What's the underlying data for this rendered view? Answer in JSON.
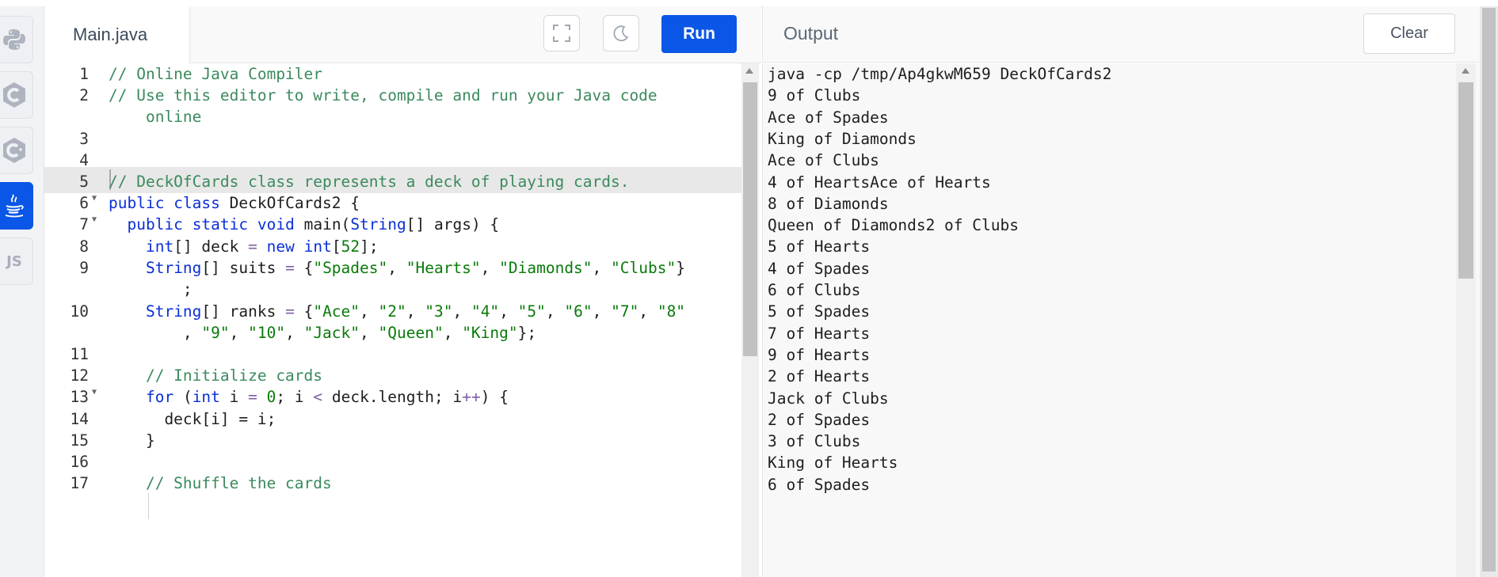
{
  "rail": {
    "languages": [
      {
        "name": "python-icon",
        "label": ""
      },
      {
        "name": "c-icon",
        "label": ""
      },
      {
        "name": "cpp-icon",
        "label": ""
      },
      {
        "name": "java-icon",
        "label": "",
        "active": true
      },
      {
        "name": "javascript-icon",
        "label": "JS"
      }
    ]
  },
  "editor": {
    "tab_label": "Main.java",
    "run_label": "Run",
    "fullscreen_icon": "fullscreen-icon",
    "theme_icon": "moon-icon",
    "lines": [
      {
        "num": "1",
        "code": "// Online Java Compiler"
      },
      {
        "num": "2",
        "code": "// Use this editor to write, compile and run your Java code"
      },
      {
        "num": "",
        "code": "    online"
      },
      {
        "num": "3",
        "code": ""
      },
      {
        "num": "4",
        "code": ""
      },
      {
        "num": "5",
        "code": "// DeckOfCards class represents a deck of playing cards."
      },
      {
        "num": "6",
        "code": "public class DeckOfCards2 {"
      },
      {
        "num": "7",
        "code": "  public static void main(String[] args) {"
      },
      {
        "num": "8",
        "code": "    int[] deck = new int[52];"
      },
      {
        "num": "9",
        "code": "    String[] suits = {\"Spades\", \"Hearts\", \"Diamonds\", \"Clubs\"}"
      },
      {
        "num": "",
        "code": "        ;"
      },
      {
        "num": "10",
        "code": "    String[] ranks = {\"Ace\", \"2\", \"3\", \"4\", \"5\", \"6\", \"7\", \"8\""
      },
      {
        "num": "",
        "code": "        , \"9\", \"10\", \"Jack\", \"Queen\", \"King\"};"
      },
      {
        "num": "11",
        "code": ""
      },
      {
        "num": "12",
        "code": "    // Initialize cards"
      },
      {
        "num": "13",
        "code": "    for (int i = 0; i < deck.length; i++) {"
      },
      {
        "num": "14",
        "code": "      deck[i] = i;"
      },
      {
        "num": "15",
        "code": "    }"
      },
      {
        "num": "16",
        "code": ""
      },
      {
        "num": "17",
        "code": "    // Shuffle the cards"
      }
    ]
  },
  "output": {
    "title": "Output",
    "clear_label": "Clear",
    "lines": [
      "java -cp /tmp/Ap4gkwM659 DeckOfCards2",
      "9 of Clubs",
      "Ace of Spades",
      "King of Diamonds",
      "Ace of Clubs",
      "4 of HeartsAce of Hearts",
      "8 of Diamonds",
      "Queen of Diamonds2 of Clubs",
      "5 of Hearts",
      "4 of Spades",
      "6 of Clubs",
      "5 of Spades",
      "7 of Hearts",
      "9 of Hearts",
      "2 of Hearts",
      "Jack of Clubs",
      "2 of Spades",
      "3 of Clubs",
      "King of Hearts",
      "6 of Spades"
    ]
  },
  "colors": {
    "accent": "#0a56e6",
    "comment": "#3b8a5d",
    "keyword": "#0b2fd6",
    "string": "#0a7a0a"
  }
}
